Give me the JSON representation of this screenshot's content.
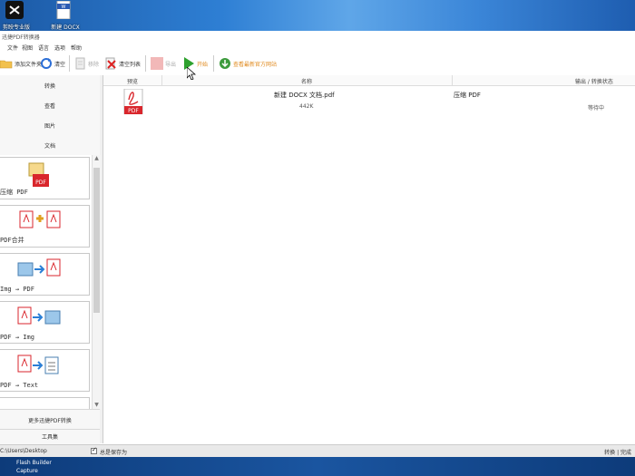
{
  "desktop": {
    "icons": [
      {
        "name": "capcut",
        "label": "剪映专业版"
      },
      {
        "name": "word-doc",
        "label": "新建 DOCX"
      }
    ],
    "taskbar_lines": [
      "Flash Builder",
      "Capture"
    ]
  },
  "window": {
    "title": "迅捷PDF转换器"
  },
  "menu": {
    "items": [
      "文件",
      "视图",
      "语言",
      "选项",
      "帮助"
    ]
  },
  "toolbar": {
    "add_files": "添加文件夹",
    "clear": "清空",
    "remove": "移除",
    "clear_list": "清空列表",
    "export": "导出",
    "start": "开始",
    "download": "查看最新官方网站"
  },
  "sidebar": {
    "categories": [
      "转换",
      "查看",
      "图片",
      "文档"
    ],
    "tools": [
      {
        "label": "压缩 PDF"
      },
      {
        "label": "PDF合并"
      },
      {
        "label": "Img → PDF"
      },
      {
        "label": "PDF → Img"
      },
      {
        "label": "PDF → Text"
      }
    ],
    "bottom_items": [
      "更多迅捷PDF转换",
      "工具集"
    ]
  },
  "table": {
    "headers": {
      "preview": "预览",
      "name": "名称",
      "status": "输出 / 转换状态"
    },
    "rows": [
      {
        "filename": "新建 DOCX 文档.pdf",
        "size": "442K",
        "operation": "压缩 PDF",
        "status": "等待中"
      }
    ]
  },
  "statusbar": {
    "path": "C:\\Users\\Desktop",
    "checkbox_label": "总是保存为",
    "right_text": "转换 | 完成"
  },
  "colors": {
    "pdf_red": "#d9262c",
    "start_green": "#2ea12e",
    "link_orange": "#e08a1e"
  }
}
